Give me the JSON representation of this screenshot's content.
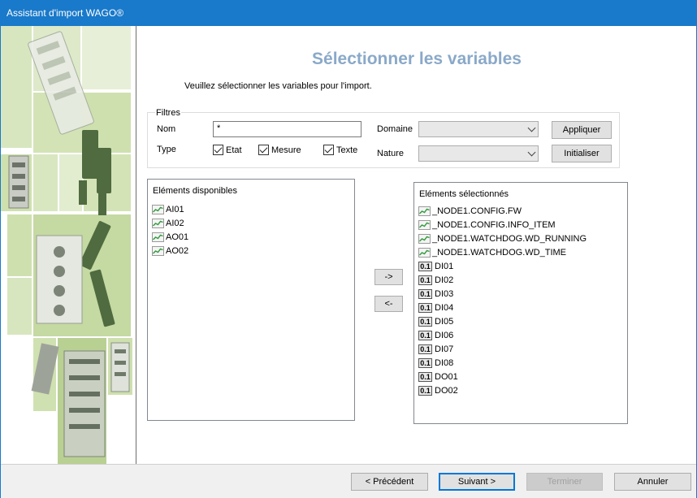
{
  "window": {
    "title": "Assistant d'import WAGO®"
  },
  "page": {
    "title": "Sélectionner les variables",
    "subtitle": "Veuillez sélectionner les variables pour l'import."
  },
  "filters": {
    "legend": "Filtres",
    "nom_label": "Nom",
    "nom_value": "*",
    "type_label": "Type",
    "types": [
      {
        "label": "Etat",
        "checked": true
      },
      {
        "label": "Mesure",
        "checked": true
      },
      {
        "label": "Texte",
        "checked": true
      }
    ],
    "domaine_label": "Domaine",
    "domaine_value": "",
    "nature_label": "Nature",
    "nature_value": "",
    "apply_label": "Appliquer",
    "reset_label": "Initialiser"
  },
  "available": {
    "header": "Eléments disponibles",
    "items": [
      {
        "label": "AI01",
        "icon": "trend-icon"
      },
      {
        "label": "AI02",
        "icon": "trend-icon"
      },
      {
        "label": "AO01",
        "icon": "trend-icon"
      },
      {
        "label": "AO02",
        "icon": "trend-icon"
      }
    ]
  },
  "transfer": {
    "add_label": "->",
    "remove_label": "<-"
  },
  "selected": {
    "header": "Eléments sélectionnés",
    "items": [
      {
        "label": "_NODE1.CONFIG.FW",
        "icon": "trend-icon"
      },
      {
        "label": "_NODE1.CONFIG.INFO_ITEM",
        "icon": "trend-icon"
      },
      {
        "label": "_NODE1.WATCHDOG.WD_RUNNING",
        "icon": "trend-icon"
      },
      {
        "label": "_NODE1.WATCHDOG.WD_TIME",
        "icon": "trend-icon"
      },
      {
        "label": "DI01",
        "icon": "binary-icon"
      },
      {
        "label": "DI02",
        "icon": "binary-icon"
      },
      {
        "label": "DI03",
        "icon": "binary-icon"
      },
      {
        "label": "DI04",
        "icon": "binary-icon"
      },
      {
        "label": "DI05",
        "icon": "binary-icon"
      },
      {
        "label": "DI06",
        "icon": "binary-icon"
      },
      {
        "label": "DI07",
        "icon": "binary-icon"
      },
      {
        "label": "DI08",
        "icon": "binary-icon"
      },
      {
        "label": "DO01",
        "icon": "binary-icon"
      },
      {
        "label": "DO02",
        "icon": "binary-icon"
      }
    ]
  },
  "binary_icon_text": "0.1",
  "footer": {
    "prev_label": "< Précédent",
    "next_label": "Suivant >",
    "finish_label": "Terminer",
    "cancel_label": "Annuler"
  }
}
